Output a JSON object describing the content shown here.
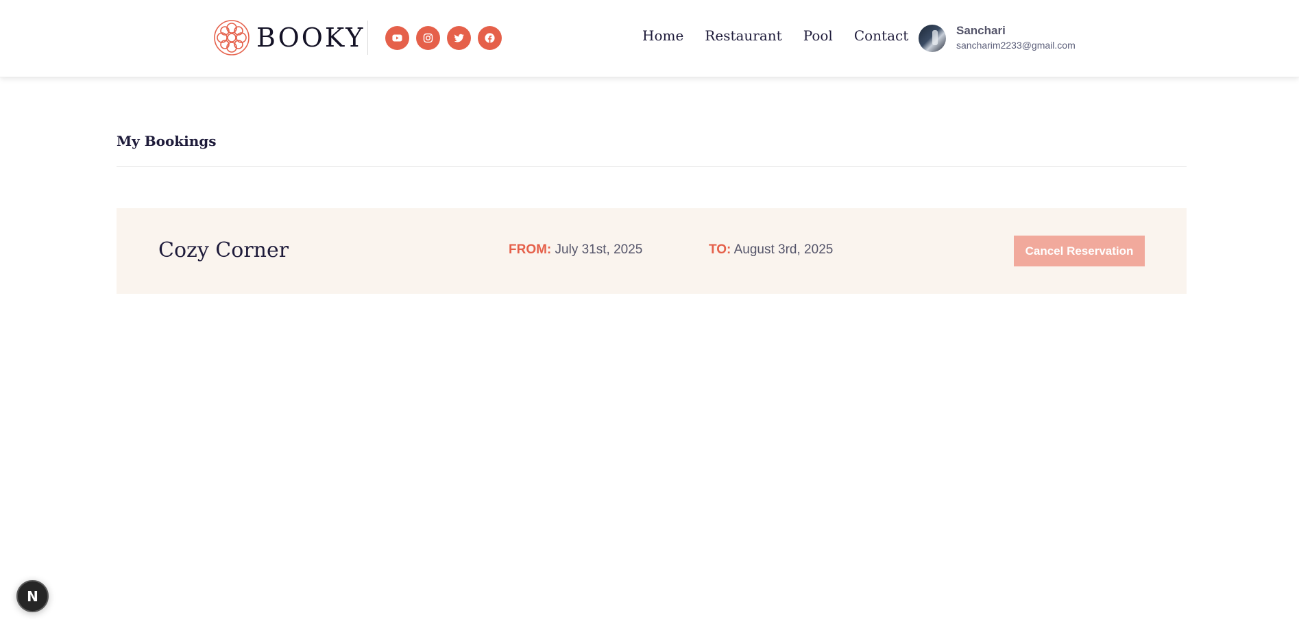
{
  "brand": {
    "name": "BOOKY",
    "accent_color": "#e5604a"
  },
  "socials": [
    {
      "icon": "youtube-icon"
    },
    {
      "icon": "instagram-icon"
    },
    {
      "icon": "twitter-icon"
    },
    {
      "icon": "facebook-icon"
    }
  ],
  "nav": {
    "home": "Home",
    "restaurant": "Restaurant",
    "pool": "Pool",
    "contact": "Contact"
  },
  "user": {
    "name": "Sanchari",
    "email": "sancharim2233@gmail.com"
  },
  "page": {
    "title": "My Bookings"
  },
  "bookings": [
    {
      "name": "Cozy Corner",
      "from_label": "FROM:",
      "from_date": "July 31st, 2025",
      "to_label": "TO:",
      "to_date": "August 3rd, 2025",
      "cancel_label": "Cancel Reservation"
    }
  ],
  "dev_badge": {
    "label": "N"
  }
}
